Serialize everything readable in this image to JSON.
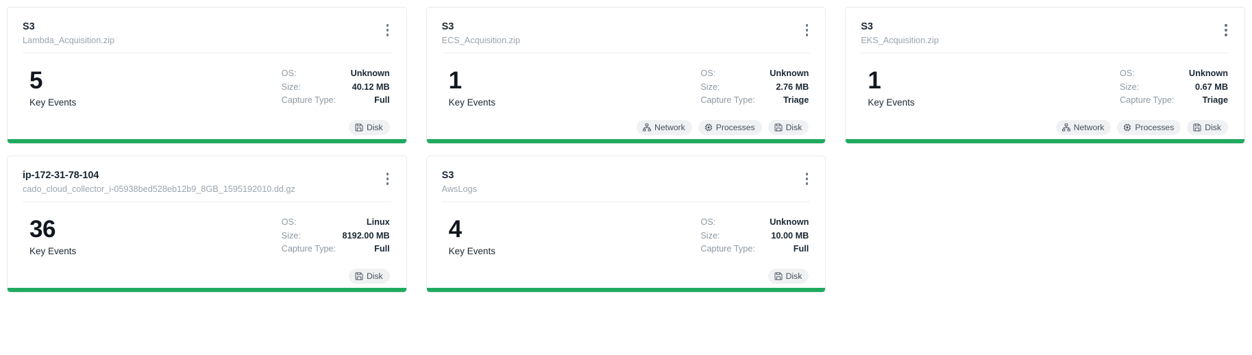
{
  "labels": {
    "os": "OS:",
    "size": "Size:",
    "capture_type": "Capture Type:",
    "key_events": "Key Events",
    "menu_icon": "kebab-menu-icon",
    "accent_color": "#1faa5e",
    "chip_icons": {
      "Network": "network-sitemap-icon",
      "Processes": "cpu-chip-icon",
      "Disk": "floppy-disk-icon"
    }
  },
  "cards": [
    {
      "title": "S3",
      "subtitle": "Lambda_Acquisition.zip",
      "key_events": "5",
      "key_events_label": "Key Events",
      "os": "Unknown",
      "size": "40.12 MB",
      "capture_type": "Full",
      "chips": [
        "Disk"
      ]
    },
    {
      "title": "S3",
      "subtitle": "ECS_Acquisition.zip",
      "key_events": "1",
      "key_events_label": "Key Events",
      "os": "Unknown",
      "size": "2.76 MB",
      "capture_type": "Triage",
      "chips": [
        "Network",
        "Processes",
        "Disk"
      ]
    },
    {
      "title": "S3",
      "subtitle": "EKS_Acquisition.zip",
      "key_events": "1",
      "key_events_label": "Key Events",
      "os": "Unknown",
      "size": "0.67 MB",
      "capture_type": "Triage",
      "chips": [
        "Network",
        "Processes",
        "Disk"
      ]
    },
    {
      "title": "ip-172-31-78-104",
      "subtitle": "cado_cloud_collector_i-05938bed528eb12b9_8GB_1595192010.dd.gz",
      "key_events": "36",
      "key_events_label": "Key Events",
      "os": "Linux",
      "size": "8192.00 MB",
      "capture_type": "Full",
      "chips": [
        "Disk"
      ]
    },
    {
      "title": "S3",
      "subtitle": "AwsLogs",
      "key_events": "4",
      "key_events_label": "Key Events",
      "os": "Unknown",
      "size": "10.00 MB",
      "capture_type": "Full",
      "chips": [
        "Disk"
      ]
    }
  ]
}
